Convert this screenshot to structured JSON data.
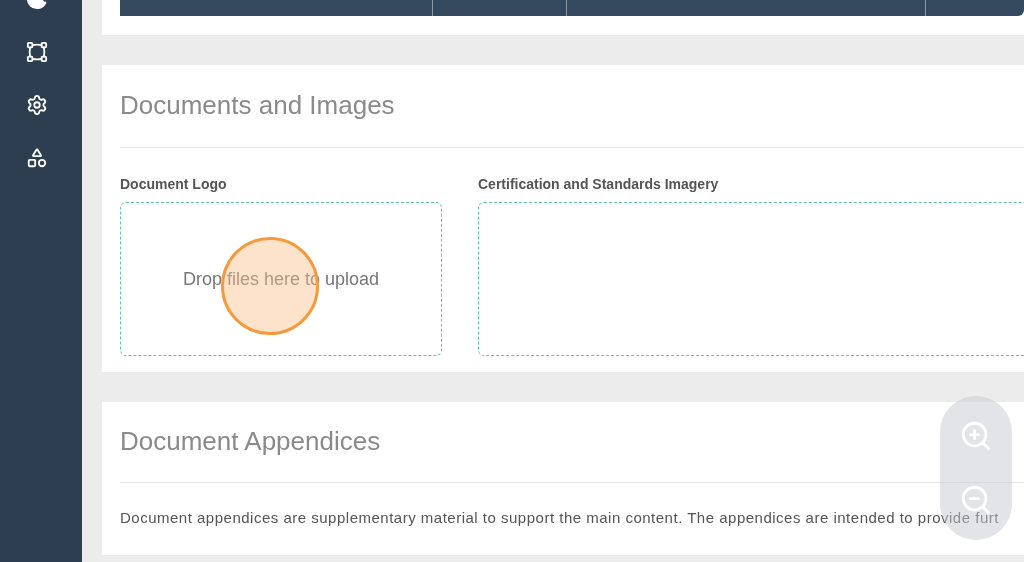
{
  "sections": [
    {
      "title": "Documents and Images",
      "uploads": [
        {
          "label": "Document Logo",
          "prompt": "Drop files here to upload"
        },
        {
          "label": "Certification and Standards Imagery"
        }
      ]
    },
    {
      "title": "Document Appendices",
      "description": "Document appendices are supplementary material to support the main content. The appendices are intended to provide furt"
    }
  ]
}
